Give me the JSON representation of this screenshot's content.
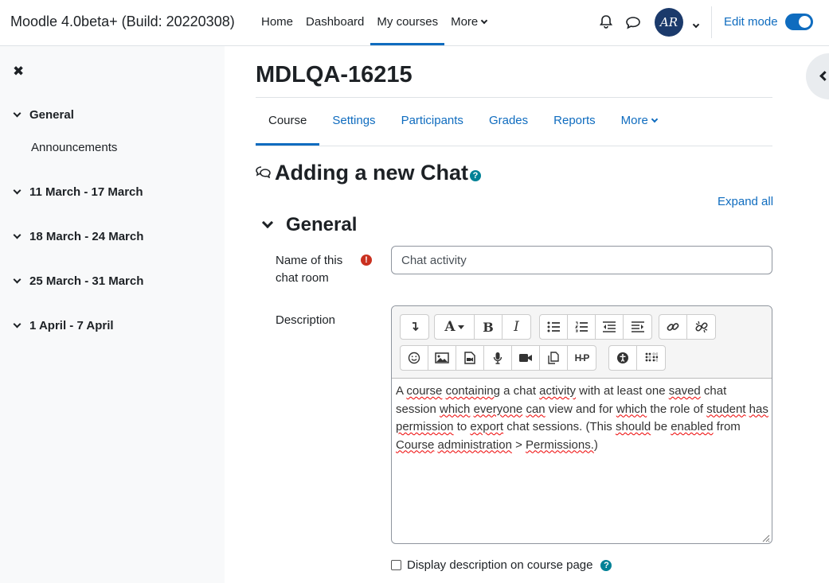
{
  "brand": "Moodle 4.0beta+ (Build: 20220308)",
  "primary_nav": {
    "home": "Home",
    "dashboard": "Dashboard",
    "my_courses": "My courses",
    "more": "More"
  },
  "user": {
    "initials": "AR"
  },
  "edit_mode": {
    "label": "Edit mode",
    "on": true
  },
  "drawer": {
    "sections": [
      {
        "label": "General"
      },
      {
        "label": "11 March - 17 March"
      },
      {
        "label": "18 March - 24 March"
      },
      {
        "label": "25 March - 31 March"
      },
      {
        "label": "1 April - 7 April"
      }
    ],
    "general_items": [
      "Announcements"
    ]
  },
  "course": {
    "title": "MDLQA-16215"
  },
  "secondary_nav": {
    "course": "Course",
    "settings": "Settings",
    "participants": "Participants",
    "grades": "Grades",
    "reports": "Reports",
    "more": "More"
  },
  "page": {
    "heading": "Adding a new Chat",
    "expand_all": "Expand all",
    "fieldset": "General",
    "name_label_1": "Name of this",
    "name_label_2": "chat room",
    "name_value": "Chat activity",
    "description_label": "Description",
    "description_parts": [
      {
        "t": "A ",
        "s": false
      },
      {
        "t": "course",
        "s": true
      },
      {
        "t": " ",
        "s": false
      },
      {
        "t": "containing",
        "s": true
      },
      {
        "t": " a chat ",
        "s": false
      },
      {
        "t": "activity",
        "s": true
      },
      {
        "t": " with at least one ",
        "s": false
      },
      {
        "t": "saved",
        "s": true
      },
      {
        "t": " chat session ",
        "s": false
      },
      {
        "t": "which",
        "s": true
      },
      {
        "t": " ",
        "s": false
      },
      {
        "t": "everyone",
        "s": true
      },
      {
        "t": " ",
        "s": false
      },
      {
        "t": "can",
        "s": true
      },
      {
        "t": " view and for ",
        "s": false
      },
      {
        "t": "which",
        "s": true
      },
      {
        "t": " the role of ",
        "s": false
      },
      {
        "t": "student",
        "s": true
      },
      {
        "t": " ",
        "s": false
      },
      {
        "t": "has",
        "s": true
      },
      {
        "t": " ",
        "s": false
      },
      {
        "t": "permission",
        "s": true
      },
      {
        "t": " to ",
        "s": false
      },
      {
        "t": "export",
        "s": true
      },
      {
        "t": " chat sessions. (This ",
        "s": false
      },
      {
        "t": "should",
        "s": true
      },
      {
        "t": " be ",
        "s": false
      },
      {
        "t": "enabled",
        "s": true
      },
      {
        "t": " from ",
        "s": false
      },
      {
        "t": "Course",
        "s": true
      },
      {
        "t": " ",
        "s": false
      },
      {
        "t": "administration",
        "s": true
      },
      {
        "t": " > ",
        "s": false
      },
      {
        "t": "Permissions.",
        "s": true
      },
      {
        "t": ")",
        "s": false
      }
    ],
    "show_description_label": "Display description on course page"
  },
  "editor_toolbar": {
    "row1": [
      [
        "collapse-icon"
      ],
      [
        "font-style-icon",
        "bold-icon",
        "italic-icon"
      ],
      [
        "unordered-list-icon",
        "ordered-list-icon",
        "outdent-icon",
        "indent-icon"
      ],
      [
        "link-icon",
        "unlink-icon"
      ]
    ],
    "row2": [
      [
        "emoji-icon",
        "image-icon",
        "media-icon",
        "record-audio-icon",
        "record-video-icon",
        "manage-files-icon",
        "h5p-icon"
      ],
      [
        "accessibility-checker-icon",
        "screenreader-helper-icon"
      ]
    ],
    "h5p_text": "H-P"
  },
  "colors": {
    "accent": "#0f6cbf",
    "required": "#ca3120",
    "help": "#008196"
  }
}
